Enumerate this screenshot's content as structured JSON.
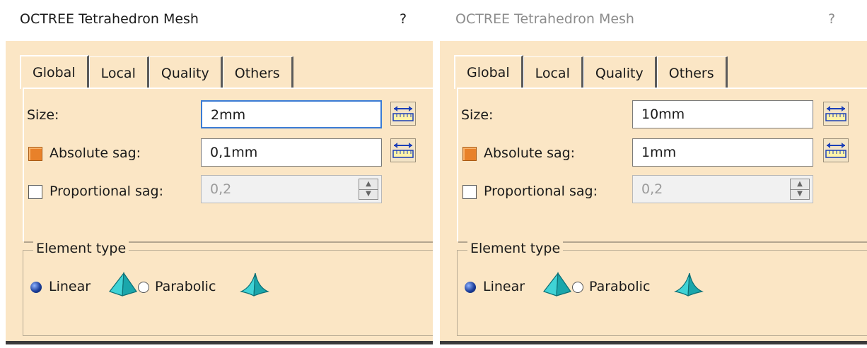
{
  "dialogs": [
    {
      "title": "OCTREE Tetrahedron Mesh",
      "help": "?",
      "tabs": [
        "Global",
        "Local",
        "Quality",
        "Others"
      ],
      "size_label": "Size:",
      "size_value": "2mm",
      "abs_sag_label": "Absolute sag:",
      "abs_sag_value": "0,1mm",
      "prop_sag_label": "Proportional sag:",
      "prop_sag_value": "0,2",
      "element_type_label": "Element type",
      "linear_label": "Linear",
      "parabolic_label": "Parabolic"
    },
    {
      "title": "OCTREE Tetrahedron Mesh",
      "help": "?",
      "tabs": [
        "Global",
        "Local",
        "Quality",
        "Others"
      ],
      "size_label": "Size:",
      "size_value": "10mm",
      "abs_sag_label": "Absolute sag:",
      "abs_sag_value": "1mm",
      "prop_sag_label": "Proportional sag:",
      "prop_sag_value": "0,2",
      "element_type_label": "Element type",
      "linear_label": "Linear",
      "parabolic_label": "Parabolic"
    }
  ],
  "colors": {
    "panel_bg": "#fbe6c5",
    "checkbox_checked": "#e8812a",
    "focus_border": "#3a7bd5",
    "tet_fill": "#2ec4c8"
  },
  "icons": [
    "ruler-icon",
    "spinner-icon",
    "linear-tetrahedron-icon",
    "parabolic-tetrahedron-icon"
  ]
}
